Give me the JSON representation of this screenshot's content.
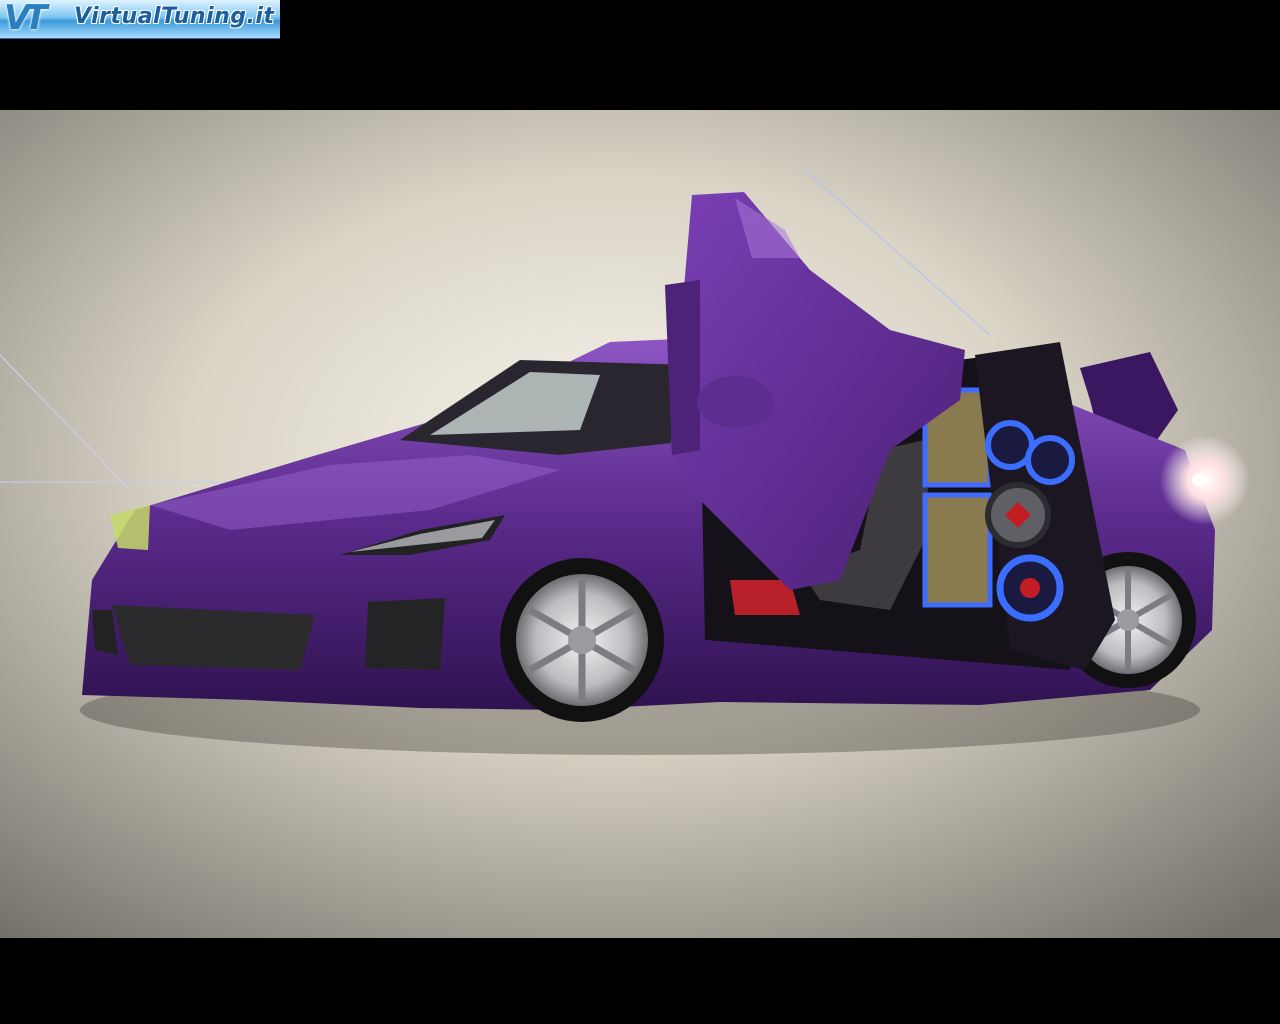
{
  "watermark": {
    "mark": "VT",
    "text": "VirtualTuning.it"
  },
  "scene": {
    "subject": "purple-sports-car-icon",
    "colors": {
      "body": "#5b2a8c",
      "body_highlight": "#8a4fc2",
      "background_light": "#f3f0e6",
      "background_dark": "#7e7a72",
      "speaker_glow": "#2f5bff",
      "letterbox": "#000000"
    }
  }
}
